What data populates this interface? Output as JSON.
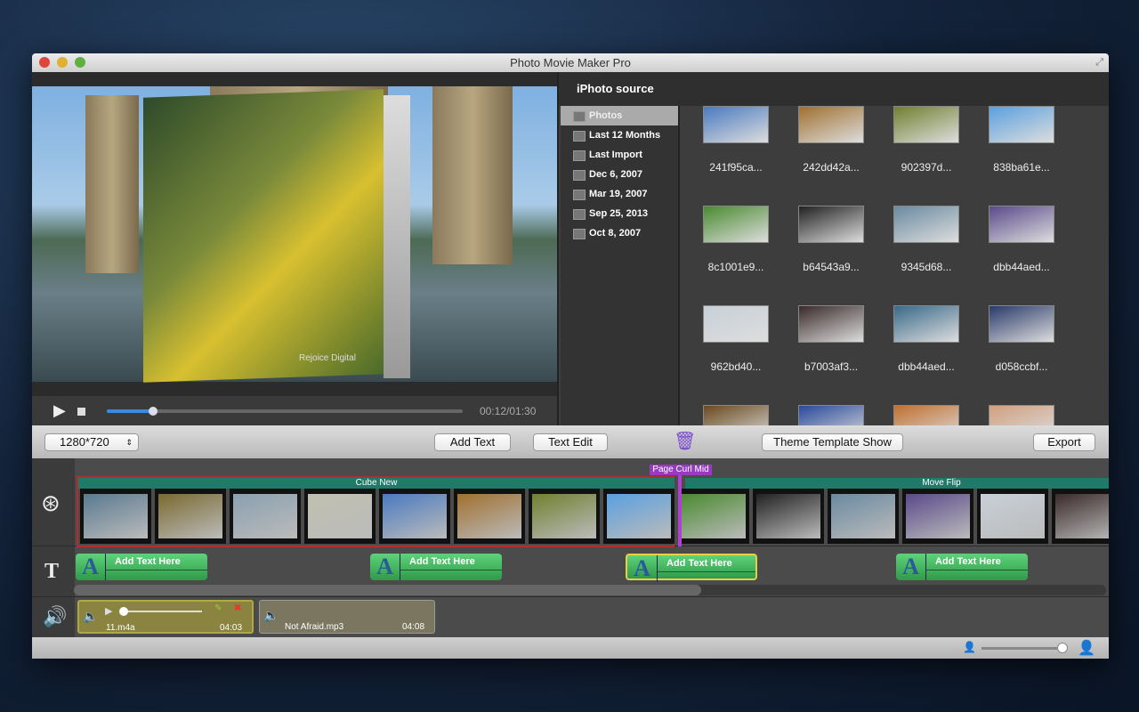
{
  "window": {
    "title": "Photo Movie Maker Pro"
  },
  "player": {
    "time": "00:12/01:30",
    "progress_fraction": 0.13,
    "watermark": "Rejoice Digital"
  },
  "source": {
    "header": "iPhoto source",
    "items": [
      {
        "label": "Photos",
        "selected": true
      },
      {
        "label": "Last 12 Months"
      },
      {
        "label": "Last Import"
      },
      {
        "label": "Dec 6, 2007"
      },
      {
        "label": "Mar 19, 2007"
      },
      {
        "label": "Sep 25, 2013"
      },
      {
        "label": "Oct 8, 2007"
      }
    ]
  },
  "photos": [
    {
      "name": "241f95ca...",
      "color": "#4a7ac0"
    },
    {
      "name": "242dd42a...",
      "color": "#a07030"
    },
    {
      "name": "902397d...",
      "color": "#708030"
    },
    {
      "name": "838ba61e...",
      "color": "#5aa0e0"
    },
    {
      "name": "8c1001e9...",
      "color": "#4a8a30"
    },
    {
      "name": "b64543a9...",
      "color": "#222"
    },
    {
      "name": "9345d68...",
      "color": "#6a8aa0"
    },
    {
      "name": "dbb44aed...",
      "color": "#5a4a8a"
    },
    {
      "name": "962bd40...",
      "color": "#c8d0d8"
    },
    {
      "name": "b7003af3...",
      "color": "#3a2a2a"
    },
    {
      "name": "dbb44aed...",
      "color": "#3a6a8a"
    },
    {
      "name": "d058ccbf...",
      "color": "#2a3a6a"
    },
    {
      "name": "",
      "color": "#6a4a20"
    },
    {
      "name": "",
      "color": "#2a4a9a"
    },
    {
      "name": "",
      "color": "#c07030"
    },
    {
      "name": "",
      "color": "#d0a080"
    }
  ],
  "toolbar": {
    "resolution": "1280*720",
    "add_text": "Add Text",
    "text_edit": "Text Edit",
    "theme": "Theme Template Show",
    "export": "Export"
  },
  "timeline": {
    "transitions": [
      "Cube New",
      "Page Curl Mid",
      "Move Flip"
    ],
    "frame_colors": [
      "#5a7a90",
      "#7a6a30",
      "#8aa0b0",
      "#c0c0b0",
      "#4a7ac0",
      "#a07030",
      "#708030",
      "#5aa0e0",
      "#4a8a30",
      "#222",
      "#6a8aa0",
      "#5a4a8a",
      "#c8d0d8",
      "#3a2a2a"
    ],
    "text_clips": [
      "Add Text Here",
      "Add Text Here",
      "Add Text Here",
      "Add Text Here"
    ],
    "audio": [
      {
        "name": "11.m4a",
        "duration": "04:03"
      },
      {
        "name": "Not Afraid.mp3",
        "duration": "04:08"
      }
    ]
  },
  "zoom_slider_fraction": 0.95,
  "colors": {
    "transition": "#1f7a6a",
    "page_curl": "#9a3ac0",
    "selected_text": "#e8d040",
    "audio_clip": "#8a8440"
  }
}
